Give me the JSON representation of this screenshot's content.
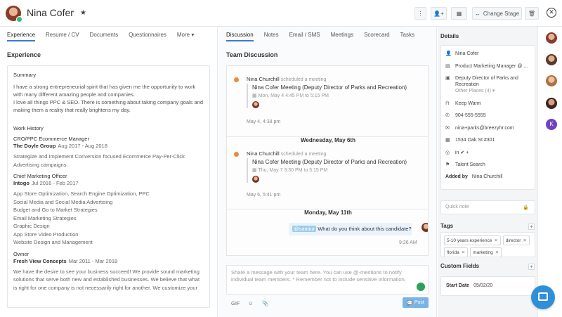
{
  "header": {
    "candidate_name": "Nina Cofer",
    "rss_icon": "rss-icon",
    "star_icon": "star-icon",
    "change_stage_label": "Change Stage",
    "actions": [
      "more-vertical-icon",
      "add-person-icon",
      "calendar-icon",
      "move-arrows-icon",
      "trash-icon",
      "close-icon"
    ]
  },
  "left": {
    "tabs": [
      "Experience",
      "Resume / CV",
      "Documents",
      "Questionnaires",
      "More"
    ],
    "title": "Experience",
    "summary_heading": "Summary",
    "summary_p1": "I have a strong entrepreneurial spirit that has given me the opportunity to work with many different amazing people and companies.",
    "summary_p2": "I love all things PPC & SEO. There is something about taking company goals and making them a reality that really brightens my day.",
    "work_heading": "Work History",
    "jobs": [
      {
        "title": "CRO/PPC Ecommerce Manager",
        "company": "The Doyle Group",
        "dates": "Aug 2017 - Aug 2018",
        "description": [
          "Strategize and Implement Conversion focused Ecommerce Pay-Per-Click Advertising campaigns."
        ]
      },
      {
        "title": "Chief Marketing Officer",
        "company": "Intogo",
        "dates": "Jul 2016 - Feb 2017",
        "description": [
          "App Store Optimization, Search Engine Optimization, PPC",
          "Social Media and Social Media Advertising",
          "Budget and Go to Market Strategies",
          "Email Marketing Strategies",
          "Graphic Design",
          "App Store Video Production",
          "Website Design and Management"
        ]
      },
      {
        "title": "Owner",
        "company": "Fresh View Concepts",
        "dates": "Mar 2011 - Mar 2018",
        "description": [
          "We have the desire to see your business succeed! We provide sound marketing solutions that serve both new and established businesses. We believe that what is right for one company is not necessarily right for another. We customize your"
        ]
      }
    ]
  },
  "middle": {
    "tabs": [
      "Discussion",
      "Notes",
      "Email / SMS",
      "Meetings",
      "Scorecard",
      "Tasks"
    ],
    "title": "Team Discussion",
    "events": [
      {
        "user": "Nina Churchill",
        "action": "scheduled a meeting",
        "meeting_title": "Nina Cofer Meeting (Deputy Director of Parks and Recreation)",
        "meeting_time": "Mon, May 4 4:45 PM to 5:15 PM",
        "stamp": "May 4, 4:38 pm"
      },
      {
        "user": "Nina Churchill",
        "action": "scheduled a meeting",
        "meeting_title": "Nina Cofer Meeting (Deputy Director of Parks and Recreation)",
        "meeting_time": "Thu, May 7 3:30 PM to 5:15 PM",
        "stamp": "May 6, 5:41 pm"
      }
    ],
    "date_dividers": [
      "Wednesday, May 6th",
      "Monday, May 11th"
    ],
    "message": {
      "mention": "@samiur",
      "text": " What do you think about this candidate?",
      "time": "9:26 AM"
    },
    "composer_placeholder": "Share a message with your team here. You can use @-mentions to notify individual team members. * Remember not to include sensitive information.",
    "tools": [
      "GIF",
      "☺",
      "📎"
    ],
    "post_label": "Post"
  },
  "right": {
    "details_title": "Details",
    "details": [
      {
        "icon": "person-icon",
        "glyph": "👤",
        "text": "Nina Cofer"
      },
      {
        "icon": "id-card-icon",
        "glyph": "▤",
        "text": "Product Marketing Manager @ ..."
      },
      {
        "icon": "briefcase-icon",
        "glyph": "▣",
        "text": "Deputy Director of Parks and Recreation",
        "sub": "Other Places (4)"
      },
      {
        "icon": "bookmark-icon",
        "glyph": "⊓",
        "text": "Keep Warm"
      },
      {
        "icon": "phone-icon",
        "glyph": "✆",
        "text": "904-555-5555"
      },
      {
        "icon": "email-icon",
        "glyph": "✉",
        "text": "nina+parks@breezyhr.com"
      },
      {
        "icon": "building-icon",
        "glyph": "▦",
        "text": "1534 Oak St #301"
      },
      {
        "icon": "social-icon",
        "glyph": "◎",
        "text": "in  ✔  +"
      },
      {
        "icon": "flag-icon",
        "glyph": "⚑",
        "text": "Talent Search"
      }
    ],
    "added_by_label": "Added by",
    "added_by_value": "Nina Churchill",
    "quick_note_placeholder": "Quick note",
    "tags_title": "Tags",
    "tags": [
      "5-10 years experience",
      "director",
      "florida",
      "marketing"
    ],
    "custom_fields_title": "Custom Fields",
    "custom_field_label": "Start Date",
    "custom_field_value": "05/02/20"
  },
  "rail": {
    "user_initial": "K"
  },
  "colors": {
    "accent": "#3a7bd5",
    "post_button": "#7ab3e6",
    "bullet": "#f08a3c",
    "mention": "#9ccbea",
    "chat_fab": "#2f8fd8",
    "rail_k": "#6f42c1"
  }
}
